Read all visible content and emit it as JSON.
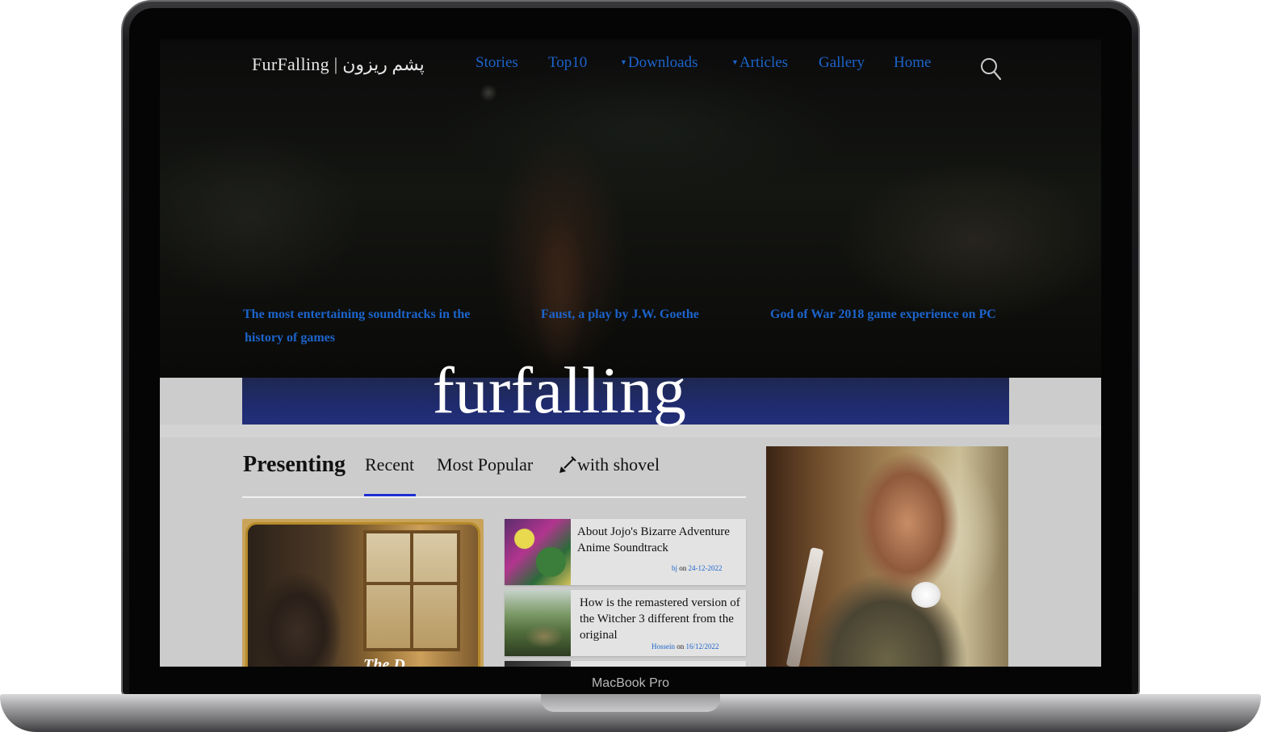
{
  "device": {
    "label": "MacBook Pro"
  },
  "site": {
    "logo": "FurFalling | پشم ریزون",
    "nav": [
      {
        "label": "Stories",
        "dropdown": false
      },
      {
        "label": "Top10",
        "dropdown": false
      },
      {
        "label": "Downloads",
        "dropdown": true
      },
      {
        "label": "Articles",
        "dropdown": true
      },
      {
        "label": "Gallery",
        "dropdown": false
      },
      {
        "label": "Home",
        "dropdown": false
      }
    ],
    "search_icon": "search-icon",
    "link_color": "#1c64cc"
  },
  "featured": [
    {
      "line1": "The most entertaining soundtracks in the",
      "line2": "history of games"
    },
    {
      "line1": "Faust, a play by J.W. Goethe"
    },
    {
      "line1": "God of War 2018 game experience on PC"
    }
  ],
  "banner": {
    "title": "furfalling"
  },
  "tabs": {
    "heading": "Presenting",
    "items": [
      "Recent",
      "Most Popular",
      "with shovel"
    ],
    "active": "Recent",
    "shovel_icon": "shovel-icon",
    "accent": "#1b2fd0"
  },
  "big_card": {
    "caption": "The D..."
  },
  "posts": [
    {
      "title": "About Jojo's Bizarre Adventure Anime Soundtrack",
      "author": "bj",
      "on": "on",
      "date": "24-12-2022"
    },
    {
      "title": "How is the remastered version of the Witcher 3 different from the original",
      "author": "Hossein",
      "on": "on",
      "date": "16/12/2022"
    }
  ]
}
